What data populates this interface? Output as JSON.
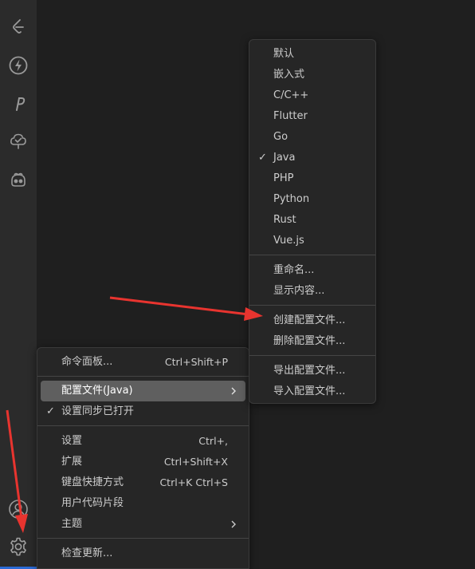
{
  "main_menu": {
    "items": [
      {
        "label": "命令面板...",
        "shortcut": "Ctrl+Shift+P"
      },
      {
        "label": "配置文件(Java)",
        "shortcut": ""
      },
      {
        "label": "设置同步已打开",
        "shortcut": ""
      },
      {
        "label": "设置",
        "shortcut": "Ctrl+,"
      },
      {
        "label": "扩展",
        "shortcut": "Ctrl+Shift+X"
      },
      {
        "label": "键盘快捷方式",
        "shortcut": "Ctrl+K Ctrl+S"
      },
      {
        "label": "用户代码片段",
        "shortcut": ""
      },
      {
        "label": "主题",
        "shortcut": ""
      },
      {
        "label": "检查更新...",
        "shortcut": ""
      }
    ]
  },
  "profile_submenu": {
    "items": [
      {
        "label": "默认"
      },
      {
        "label": "嵌入式"
      },
      {
        "label": "C/C++"
      },
      {
        "label": "Flutter"
      },
      {
        "label": "Go"
      },
      {
        "label": "Java",
        "checked": true
      },
      {
        "label": "PHP"
      },
      {
        "label": "Python"
      },
      {
        "label": "Rust"
      },
      {
        "label": "Vue.js"
      },
      {
        "label": "重命名..."
      },
      {
        "label": "显示内容..."
      },
      {
        "label": "创建配置文件..."
      },
      {
        "label": "删除配置文件..."
      },
      {
        "label": "导出配置文件..."
      },
      {
        "label": "导入配置文件..."
      }
    ]
  },
  "activity_bar": {
    "icons": [
      "leetcode-icon",
      "lightning-icon",
      "p-icon",
      "tree-check-icon",
      "copilot-icon",
      "account-icon",
      "gear-icon"
    ]
  },
  "colors": {
    "arrow": "#e8342f",
    "active_item": "#5f5f5f",
    "menu_bg": "#262626",
    "editor_bg": "#1f1f1f",
    "activity_bg": "#2b2b2b"
  }
}
